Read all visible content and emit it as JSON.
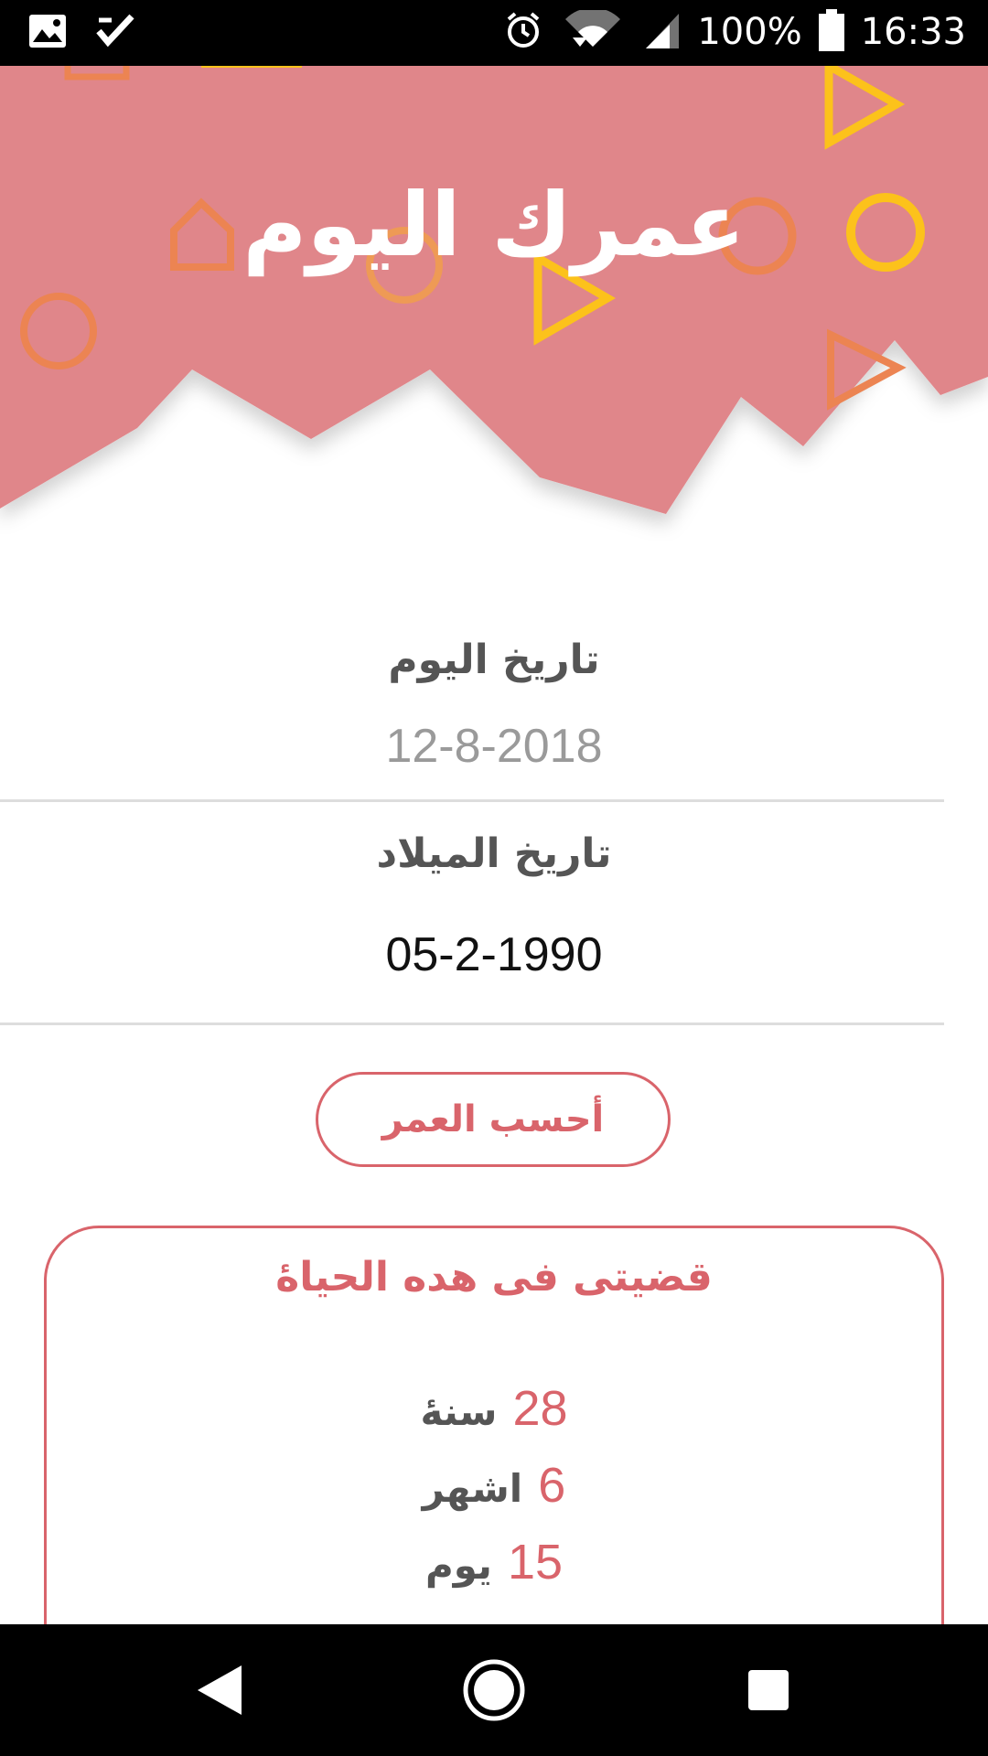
{
  "status_bar": {
    "battery": "100%",
    "time": "16:33",
    "icons": [
      "image-icon",
      "check-app-icon",
      "alarm-icon",
      "wifi-icon",
      "signal-icon",
      "battery-icon"
    ]
  },
  "header": {
    "title": "عمرك اليوم",
    "background_color": "#e0868a"
  },
  "today": {
    "label": "تاريخ اليوم",
    "value": "12-8-2018"
  },
  "birth": {
    "label": "تاريخ الميلاد",
    "value": "05-2-1990"
  },
  "calculate_button": {
    "label": "أحسب العمر"
  },
  "result": {
    "title": "قضيتى فى هده الحياۀ",
    "years_value": "28",
    "years_unit": "سنۀ",
    "months_value": "6",
    "months_unit": "اشهر",
    "days_value": "15",
    "days_unit": "يوم"
  },
  "colors": {
    "accent": "#d9646b",
    "header_pink": "#e0868a",
    "yellow": "#fcc21b",
    "orange": "#ec8452"
  },
  "nav_bar": {
    "icons": [
      "back-icon",
      "home-icon",
      "recents-icon"
    ]
  }
}
